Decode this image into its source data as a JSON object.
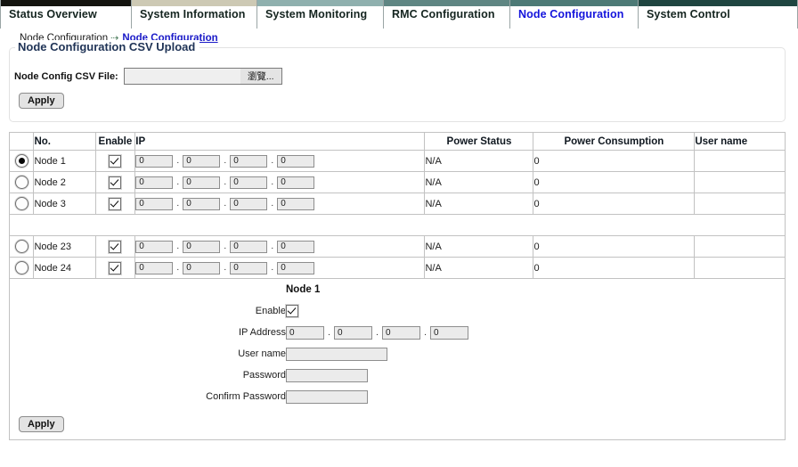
{
  "tabs": [
    {
      "label": "Status Overview",
      "strip": "#14140f",
      "active": false
    },
    {
      "label": "System Information",
      "strip": "#cdc9b4",
      "active": false
    },
    {
      "label": "System Monitoring",
      "strip": "#8fb0ae",
      "active": false
    },
    {
      "label": "RMC Configuration",
      "strip": "#5f8683",
      "active": false
    },
    {
      "label": "Node Configuration",
      "strip": "#4d7a76",
      "active": true
    },
    {
      "label": "System Control",
      "strip": "#1f4540",
      "active": false
    }
  ],
  "breadcrumb": {
    "parent": "Node Configuration",
    "separator": "⇢",
    "current": "Node Configuration"
  },
  "csv_upload": {
    "legend": "Node Configuration CSV Upload",
    "file_label": "Node Config CSV File:",
    "file_value": "",
    "file_placeholder": "",
    "browse_label": "瀏覽...",
    "apply_label": "Apply"
  },
  "table": {
    "headers": {
      "select": "",
      "no": "No.",
      "enable": "Enable",
      "ip": "IP",
      "power_status": "Power Status",
      "power_consumption": "Power Consumption",
      "user_name": "User name"
    },
    "rows_top": [
      {
        "selected": true,
        "no": "Node 1",
        "enabled": true,
        "ip": [
          "0",
          "0",
          "0",
          "0"
        ],
        "power_status": "N/A",
        "power_consumption": "0",
        "user_name": ""
      },
      {
        "selected": false,
        "no": "Node 2",
        "enabled": true,
        "ip": [
          "0",
          "0",
          "0",
          "0"
        ],
        "power_status": "N/A",
        "power_consumption": "0",
        "user_name": ""
      },
      {
        "selected": false,
        "no": "Node 3",
        "enabled": true,
        "ip": [
          "0",
          "0",
          "0",
          "0"
        ],
        "power_status": "N/A",
        "power_consumption": "0",
        "user_name": ""
      }
    ],
    "rows_bottom": [
      {
        "selected": false,
        "no": "Node 23",
        "enabled": true,
        "ip": [
          "0",
          "0",
          "0",
          "0"
        ],
        "power_status": "N/A",
        "power_consumption": "0",
        "user_name": ""
      },
      {
        "selected": false,
        "no": "Node 24",
        "enabled": true,
        "ip": [
          "0",
          "0",
          "0",
          "0"
        ],
        "power_status": "N/A",
        "power_consumption": "0",
        "user_name": ""
      }
    ]
  },
  "detail": {
    "title": "Node 1",
    "enable_label": "Enable",
    "enabled": true,
    "ip_label": "IP Address",
    "ip": [
      "0",
      "0",
      "0",
      "0"
    ],
    "user_label": "User name",
    "user_value": "",
    "password_label": "Password",
    "password_value": "",
    "confirm_label": "Confirm Password",
    "confirm_value": "",
    "apply_label": "Apply"
  },
  "dot_separator": "."
}
